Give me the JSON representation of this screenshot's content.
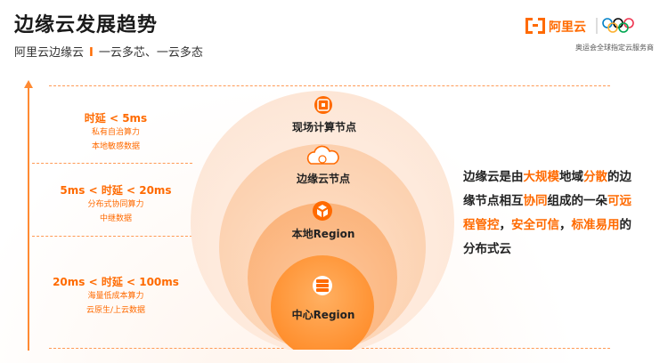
{
  "header": {
    "title": "边缘云发展趋势",
    "subtitle_brand": "阿里云边缘云",
    "subtitle_sep": "I",
    "subtitle_text": "一云多芯、一云多态"
  },
  "logo": {
    "brand": "阿里云",
    "tagline": "奥运会全球指定云服务商"
  },
  "latency_tiers": [
    {
      "head": "时延 < 5ms",
      "lines": [
        "私有自治算力",
        "本地敏感数据"
      ]
    },
    {
      "head": "5ms < 时延 < 20ms",
      "lines": [
        "分布式协同算力",
        "中继数据"
      ]
    },
    {
      "head": "20ms < 时延 < 100ms",
      "lines": [
        "海量低成本算力",
        "云原生/上云数据"
      ]
    }
  ],
  "layers": [
    {
      "label": "现场计算节点",
      "icon": "chip-icon"
    },
    {
      "label": "边缘云节点",
      "icon": "cloud-icon"
    },
    {
      "label": "本地Region",
      "icon": "cubes-icon"
    },
    {
      "label": "中心Region",
      "icon": "server-icon"
    }
  ],
  "description": {
    "segments": [
      {
        "text": "边缘云是由",
        "hl": false
      },
      {
        "text": "大规模",
        "hl": true
      },
      {
        "text": "地域",
        "hl": false
      },
      {
        "text": "分散",
        "hl": true
      },
      {
        "text": "的边缘节点相互",
        "hl": false
      },
      {
        "text": "协同",
        "hl": true
      },
      {
        "text": "组成的一朵",
        "hl": false
      },
      {
        "text": "可远程管控",
        "hl": true
      },
      {
        "text": "，",
        "hl": false
      },
      {
        "text": "安全可信",
        "hl": true
      },
      {
        "text": "，",
        "hl": false
      },
      {
        "text": "标准易用",
        "hl": true
      },
      {
        "text": "的分布式云",
        "hl": false
      }
    ]
  },
  "colors": {
    "accent": "#ff6a00",
    "ring_outer": "#fde9dc",
    "ring_mid": "#fcd2b4",
    "ring_inner": "#fcb988",
    "core": "#ff9a3c"
  }
}
